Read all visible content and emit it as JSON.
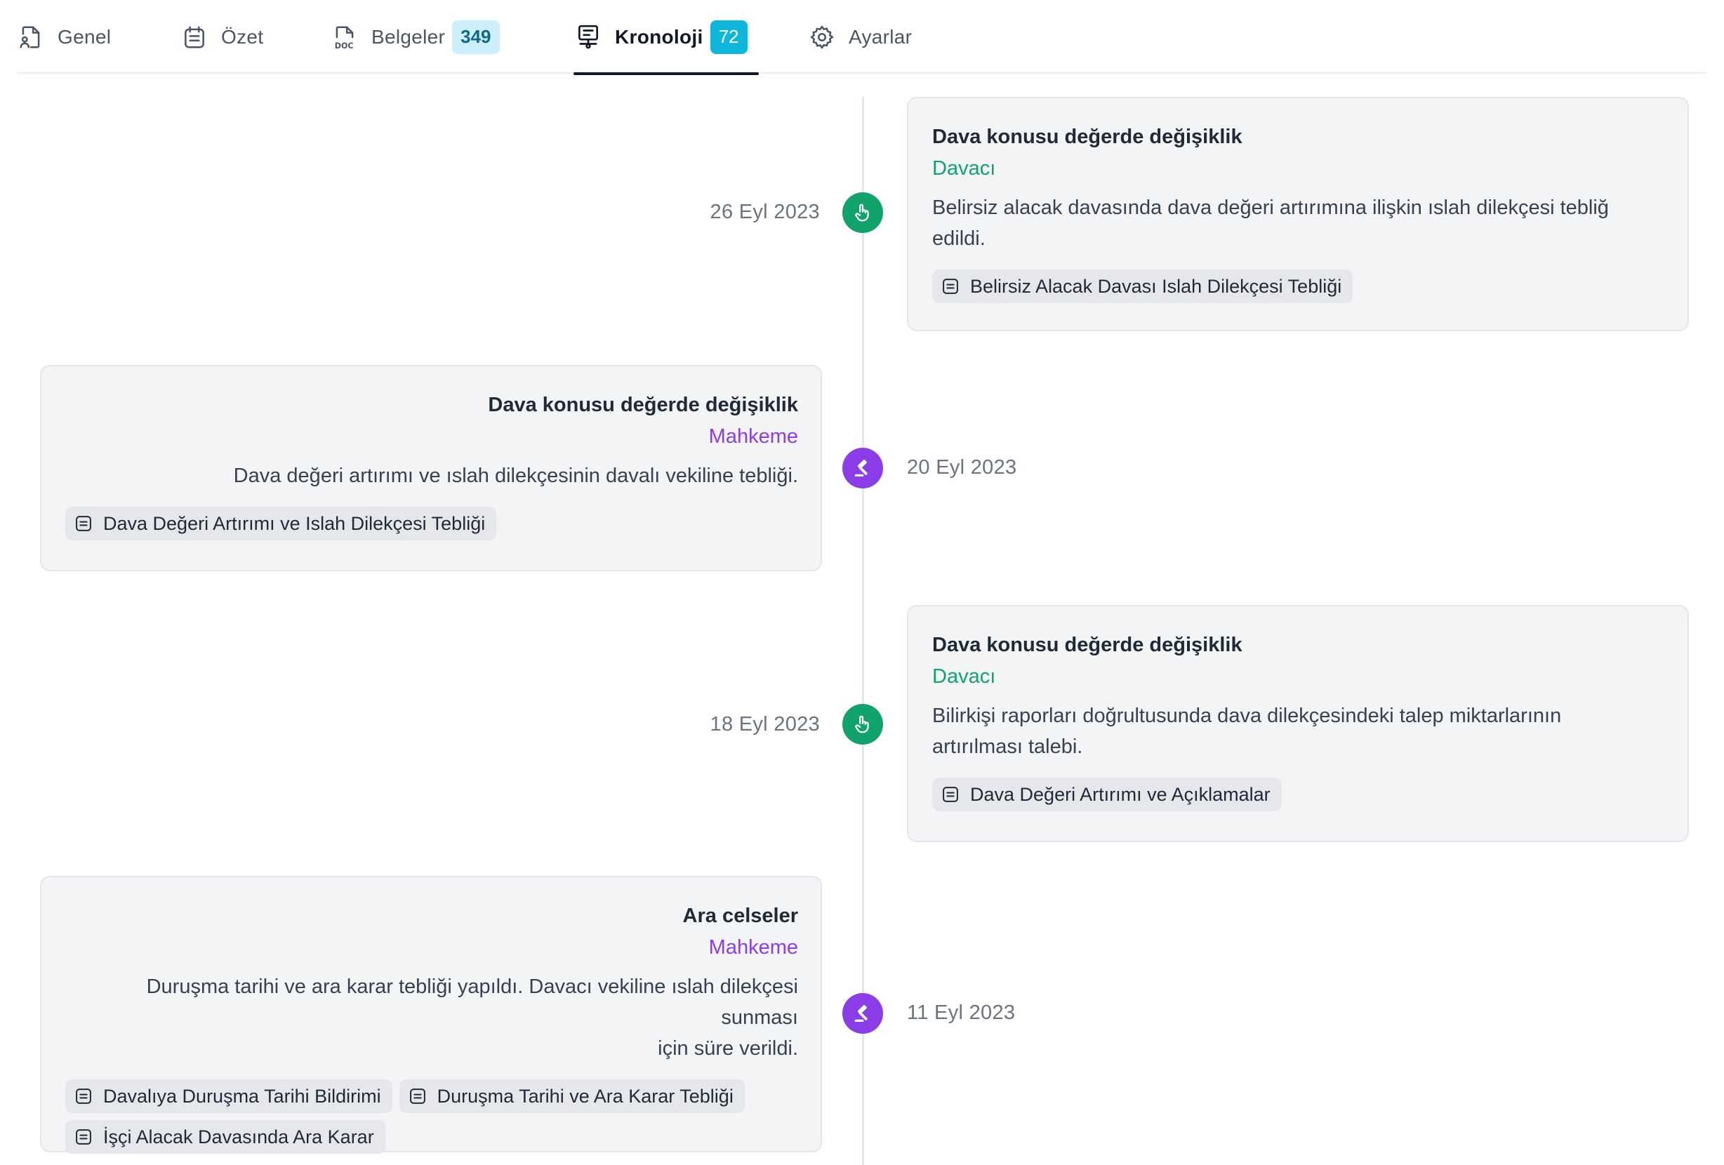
{
  "tabs": [
    {
      "label": "Genel",
      "icon": "file-user-icon"
    },
    {
      "label": "Özet",
      "icon": "calendar-list-icon"
    },
    {
      "label": "Belgeler",
      "icon": "doc-file-icon",
      "badge": "349"
    },
    {
      "label": "Kronoloji",
      "icon": "timeline-icon",
      "badge": "72",
      "active": true
    },
    {
      "label": "Ayarlar",
      "icon": "gear-icon"
    }
  ],
  "events": [
    {
      "date": "26 Eyl 2023",
      "title": "Dava konusu değerde değişiklik",
      "actor": "Davacı",
      "desc_lines": [
        "Belirsiz alacak davasında dava değeri artırımına ilişkin ıslah dilekçesi tebliğ",
        "edildi."
      ],
      "documents": [
        "Belirsiz Alacak Davası Islah Dilekçesi Tebliği"
      ]
    },
    {
      "date": "20 Eyl 2023",
      "title": "Dava konusu değerde değişiklik",
      "actor": "Mahkeme",
      "desc_lines": [
        "Dava değeri artırımı ve ıslah dilekçesinin davalı vekiline tebliği."
      ],
      "documents": [
        "Dava Değeri Artırımı ve Islah Dilekçesi Tebliği"
      ]
    },
    {
      "date": "18 Eyl 2023",
      "title": "Dava konusu değerde değişiklik",
      "actor": "Davacı",
      "desc_lines": [
        "Bilirkişi raporları doğrultusunda dava dilekçesindeki talep miktarlarının",
        "artırılması talebi."
      ],
      "documents": [
        "Dava Değeri Artırımı ve Açıklamalar"
      ]
    },
    {
      "date": "11 Eyl 2023",
      "title": "Ara celseler",
      "actor": "Mahkeme",
      "desc_lines": [
        "Duruşma tarihi ve ara karar tebliği yapıldı. Davacı vekiline ıslah dilekçesi sunması",
        "için süre verildi."
      ],
      "documents": [
        "Davalıya Duruşma Tarihi Bildirimi",
        "Duruşma Tarihi ve Ara Karar Tebliği",
        "İşçi Alacak Davasında Ara Karar"
      ]
    }
  ],
  "colors": {
    "plaintiff": "#10a36b",
    "court": "#8b3ee8",
    "badge": "#0fb6dc"
  }
}
